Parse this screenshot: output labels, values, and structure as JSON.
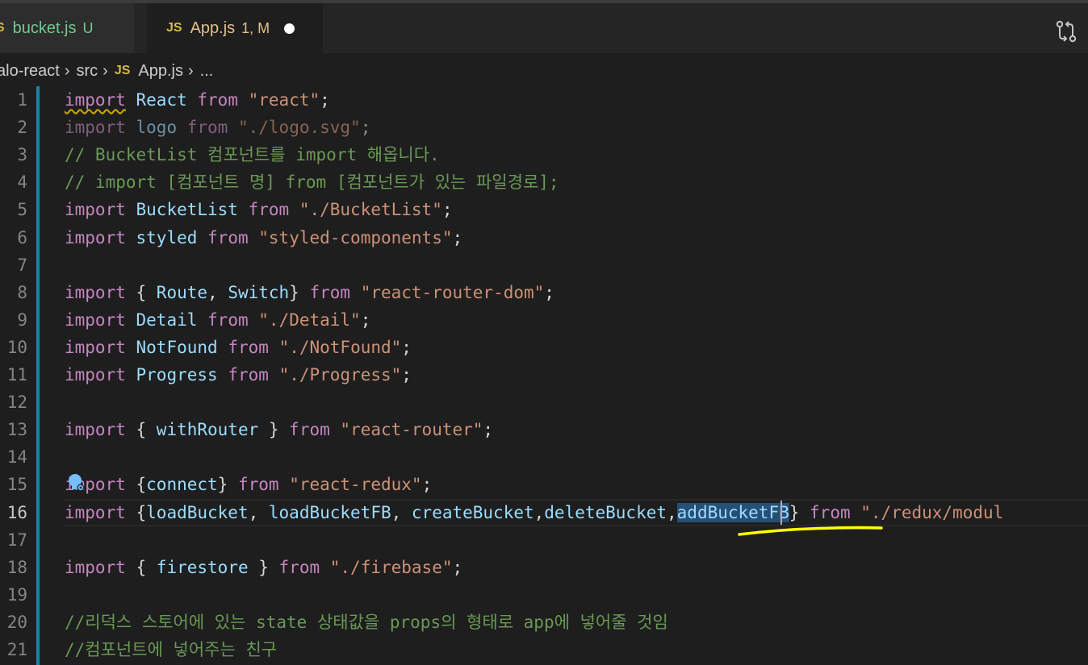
{
  "tabs": [
    {
      "badge": "JS",
      "name": "bucket.js",
      "status": "U"
    },
    {
      "badge": "JS",
      "name": "App.js",
      "status": "1, M"
    }
  ],
  "breadcrumb": {
    "items": [
      "alo-react",
      "src",
      "App.js",
      "..."
    ],
    "file_badge": "JS"
  },
  "icons": {
    "compare": "git-compare-icon",
    "lightbulb": "lightbulb-icon",
    "chevron": "chevron-right-icon"
  },
  "colors": {
    "keyword": "#c586c0",
    "variable": "#9cdcfe",
    "string": "#ce9178",
    "comment": "#6a9955",
    "selection": "#264f78",
    "annotation": "#ffff00"
  },
  "editor": {
    "active_line": 16,
    "line_numbers": [
      "1",
      "2",
      "3",
      "4",
      "5",
      "6",
      "7",
      "8",
      "9",
      "10",
      "11",
      "12",
      "13",
      "14",
      "15",
      "16",
      "17",
      "18",
      "19",
      "20",
      "21"
    ],
    "lines": [
      [
        [
          "k",
          "import"
        ],
        [
          "p",
          " "
        ],
        [
          "v",
          "React"
        ],
        [
          "p",
          " "
        ],
        [
          "k",
          "from"
        ],
        [
          "p",
          " "
        ],
        [
          "s",
          "\"react\""
        ],
        [
          "p",
          ";"
        ]
      ],
      [
        [
          "k",
          "import"
        ],
        [
          "p",
          " "
        ],
        [
          "v",
          "logo"
        ],
        [
          "p",
          " "
        ],
        [
          "k",
          "from"
        ],
        [
          "p",
          " "
        ],
        [
          "s",
          "\"./logo.svg\""
        ],
        [
          "p",
          ";"
        ]
      ],
      [
        [
          "c",
          "// BucketList 컴포넌트를 import 해옵니다."
        ]
      ],
      [
        [
          "c",
          "// import [컴포넌트 명] from [컴포넌트가 있는 파일경로];"
        ]
      ],
      [
        [
          "k",
          "import"
        ],
        [
          "p",
          " "
        ],
        [
          "v",
          "BucketList"
        ],
        [
          "p",
          " "
        ],
        [
          "k",
          "from"
        ],
        [
          "p",
          " "
        ],
        [
          "s",
          "\"./BucketList\""
        ],
        [
          "p",
          ";"
        ]
      ],
      [
        [
          "k",
          "import"
        ],
        [
          "p",
          " "
        ],
        [
          "v",
          "styled"
        ],
        [
          "p",
          " "
        ],
        [
          "k",
          "from"
        ],
        [
          "p",
          " "
        ],
        [
          "s",
          "\"styled-components\""
        ],
        [
          "p",
          ";"
        ]
      ],
      [],
      [
        [
          "k",
          "import"
        ],
        [
          "p",
          " { "
        ],
        [
          "v",
          "Route"
        ],
        [
          "p",
          ", "
        ],
        [
          "v",
          "Switch"
        ],
        [
          "p",
          "} "
        ],
        [
          "k",
          "from"
        ],
        [
          "p",
          " "
        ],
        [
          "s",
          "\"react-router-dom\""
        ],
        [
          "p",
          ";"
        ]
      ],
      [
        [
          "k",
          "import"
        ],
        [
          "p",
          " "
        ],
        [
          "v",
          "Detail"
        ],
        [
          "p",
          " "
        ],
        [
          "k",
          "from"
        ],
        [
          "p",
          " "
        ],
        [
          "s",
          "\"./Detail\""
        ],
        [
          "p",
          ";"
        ]
      ],
      [
        [
          "k",
          "import"
        ],
        [
          "p",
          " "
        ],
        [
          "v",
          "NotFound"
        ],
        [
          "p",
          " "
        ],
        [
          "k",
          "from"
        ],
        [
          "p",
          " "
        ],
        [
          "s",
          "\"./NotFound\""
        ],
        [
          "p",
          ";"
        ]
      ],
      [
        [
          "k",
          "import"
        ],
        [
          "p",
          " "
        ],
        [
          "v",
          "Progress"
        ],
        [
          "p",
          " "
        ],
        [
          "k",
          "from"
        ],
        [
          "p",
          " "
        ],
        [
          "s",
          "\"./Progress\""
        ],
        [
          "p",
          ";"
        ]
      ],
      [],
      [
        [
          "k",
          "import"
        ],
        [
          "p",
          " { "
        ],
        [
          "v",
          "withRouter"
        ],
        [
          "p",
          " } "
        ],
        [
          "k",
          "from"
        ],
        [
          "p",
          " "
        ],
        [
          "s",
          "\"react-router\""
        ],
        [
          "p",
          ";"
        ]
      ],
      [],
      [
        [
          "k",
          "import"
        ],
        [
          "p",
          " {"
        ],
        [
          "v",
          "connect"
        ],
        [
          "p",
          "} "
        ],
        [
          "k",
          "from"
        ],
        [
          "p",
          " "
        ],
        [
          "s",
          "\"react-redux\""
        ],
        [
          "p",
          ";"
        ]
      ],
      [
        [
          "k",
          "import"
        ],
        [
          "p",
          " {"
        ],
        [
          "v",
          "loadBucket"
        ],
        [
          "p",
          ", "
        ],
        [
          "v",
          "loadBucketFB"
        ],
        [
          "p",
          ", "
        ],
        [
          "v",
          "createBucket"
        ],
        [
          "p",
          ","
        ],
        [
          "v",
          "deleteBucket"
        ],
        [
          "p",
          ","
        ],
        [
          "vsel",
          "addBucketFB"
        ],
        [
          "p",
          "} "
        ],
        [
          "k",
          "from"
        ],
        [
          "p",
          " "
        ],
        [
          "s",
          "\"./redux/modul"
        ]
      ],
      [],
      [
        [
          "k",
          "import"
        ],
        [
          "p",
          " { "
        ],
        [
          "v",
          "firestore"
        ],
        [
          "p",
          " } "
        ],
        [
          "k",
          "from"
        ],
        [
          "p",
          " "
        ],
        [
          "s",
          "\"./firebase\""
        ],
        [
          "p",
          ";"
        ]
      ],
      [],
      [
        [
          "c",
          "//리덕스 스토어에 있는 state 상태값을 props의 형태로 app에 넣어줄 것임"
        ]
      ],
      [
        [
          "c",
          "//컴포넌트에 넣어주는 친구"
        ]
      ]
    ]
  }
}
